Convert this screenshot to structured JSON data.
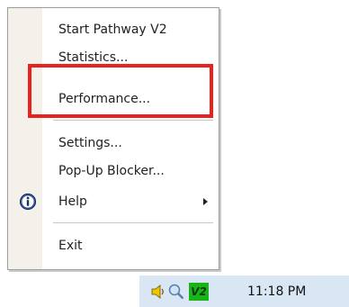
{
  "menu": {
    "items": [
      {
        "label": "Start Pathway V2"
      },
      {
        "label": "Statistics..."
      },
      {
        "label": "Performance..."
      },
      {
        "label": "Settings..."
      },
      {
        "label": "Pop-Up Blocker..."
      },
      {
        "label": "Help",
        "icon": "info-icon",
        "submenu": true
      },
      {
        "label": "Exit"
      }
    ]
  },
  "highlight_color": "#e8231f",
  "taskbar": {
    "icons": [
      "speaker-icon",
      "magnifier-icon",
      "pathway-v2-icon"
    ],
    "v2_label": "V2",
    "clock": "11:18 PM"
  }
}
